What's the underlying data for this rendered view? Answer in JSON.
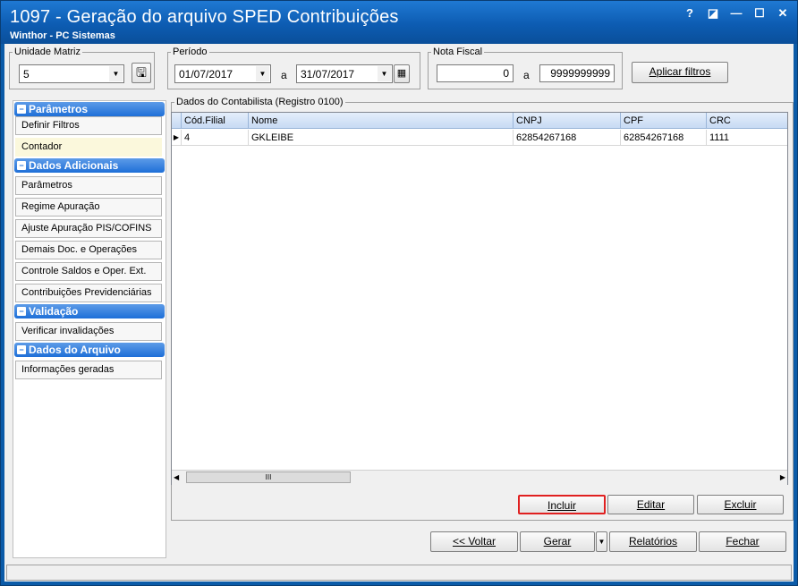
{
  "window": {
    "title": "1097 - Geração do arquivo SPED Contribuições",
    "subtitle": "Winthor - PC Sistemas",
    "controls": [
      "?",
      "◪",
      "—",
      "☐",
      "✕"
    ]
  },
  "filters": {
    "unidade_legend": "Unidade Matriz",
    "unidade_value": "5",
    "periodo_legend": "Período",
    "periodo_start": "01/07/2017",
    "periodo_sep": "a",
    "periodo_end": "31/07/2017",
    "nota_legend": "Nota Fiscal",
    "nota_start": "0",
    "nota_sep": "a",
    "nota_end": "9999999999",
    "apply_label": "Aplicar filtros"
  },
  "sidebar": {
    "groups": [
      {
        "label": "Parâmetros",
        "items": [
          "Definir Filtros",
          "Contador"
        ]
      },
      {
        "label": "Dados Adicionais",
        "items": [
          "Parâmetros",
          "Regime Apuração",
          "Ajuste Apuração PIS/COFINS",
          "Demais Doc. e Operações",
          "Controle Saldos e Oper. Ext.",
          "Contribuições Previdenciárias"
        ]
      },
      {
        "label": "Validação",
        "items": [
          "Verificar invalidações"
        ]
      },
      {
        "label": "Dados do Arquivo",
        "items": [
          "Informações geradas"
        ]
      }
    ]
  },
  "contabilista": {
    "legend": "Dados do Contabilista (Registro 0100)",
    "columns": [
      "Cód.Filial",
      "Nome",
      "CNPJ",
      "CPF",
      "CRC"
    ],
    "rows": [
      [
        "4",
        "GKLEIBE",
        "62854267168",
        "62854267168",
        "1111"
      ]
    ],
    "scroll_grip": "III",
    "include_label": "Incluir",
    "edit_label": "Editar",
    "delete_label": "Excluir"
  },
  "footer": {
    "back_label": "<< Voltar",
    "generate_label": "Gerar",
    "reports_label": "Relatórios",
    "close_label": "Fechar"
  },
  "colors": {
    "title_bar": "#0d5cb2",
    "group_header": "#1e6fd8",
    "active_item": "#fbf8dc",
    "highlight_border": "#e02020"
  }
}
